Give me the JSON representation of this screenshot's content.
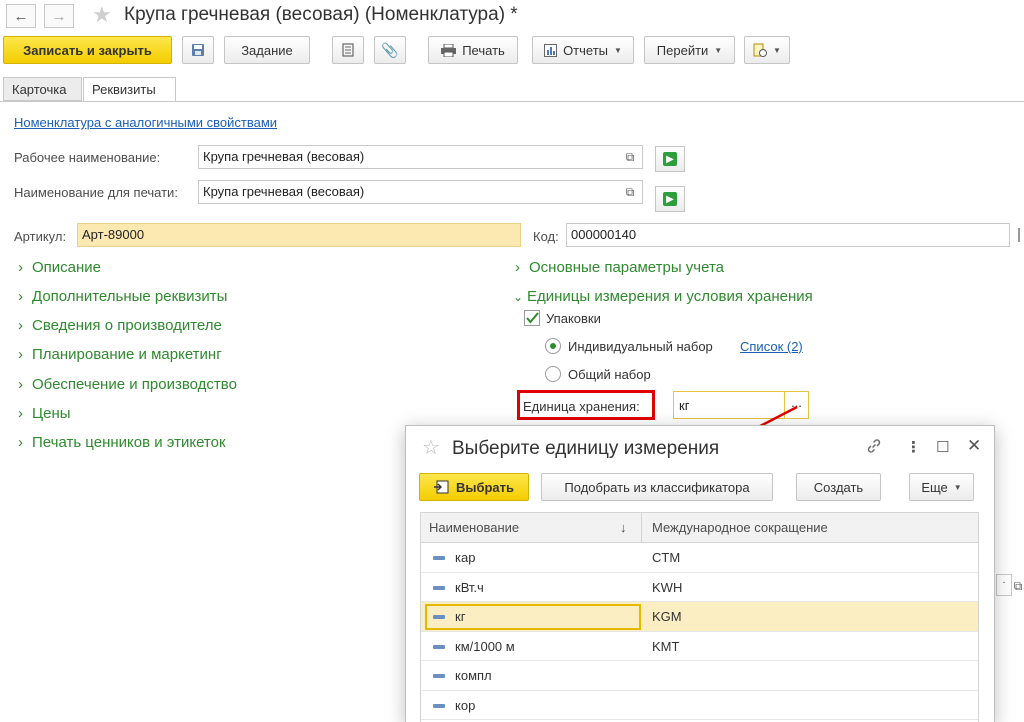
{
  "window": {
    "title": "Крупа гречневая (весовая) (Номенклатура) *"
  },
  "toolbar": {
    "save_close": "Записать и закрыть",
    "task": "Задание",
    "print": "Печать",
    "reports": "Отчеты",
    "goto": "Перейти"
  },
  "tabs": [
    "Карточка",
    "Реквизиты"
  ],
  "form": {
    "similar_link": "Номенклатура с аналогичными свойствами",
    "work_name_label": "Рабочее наименование:",
    "work_name_value": "Крупа гречневая (весовая)",
    "print_name_label": "Наименование для печати:",
    "print_name_value": "Крупа гречневая (весовая)",
    "article_label": "Артикул:",
    "article_value": "Арт-89000",
    "code_label": "Код:",
    "code_value": "000000140"
  },
  "left_groups": [
    "Описание",
    "Дополнительные реквизиты",
    "Сведения о производителе",
    "Планирование и маркетинг",
    "Обеспечение и производство",
    "Цены",
    "Печать ценников и этикеток"
  ],
  "right_groups": {
    "accounting": "Основные параметры учета",
    "units": "Единицы измерения и условия хранения",
    "packaging_label": "Упаковки",
    "individual_set": "Индивидуальный набор",
    "list_link": "Список (2)",
    "common_set": "Общий набор",
    "storage_unit_label": "Единица хранения:",
    "storage_unit_value": "кг",
    "storage_unit_btn": "..."
  },
  "dialog": {
    "title": "Выберите единицу измерения",
    "choose": "Выбрать",
    "classifier": "Подобрать из классификатора",
    "create": "Создать",
    "more": "Еще",
    "col_name": "Наименование",
    "col_intl": "Международное сокращение",
    "sort_arrow": "↓",
    "rows": [
      {
        "name": "кар",
        "code": "CTM"
      },
      {
        "name": "кВт.ч",
        "code": "KWH"
      },
      {
        "name": "кг",
        "code": "KGM"
      },
      {
        "name": "км/1000 м",
        "code": "KMT"
      },
      {
        "name": "компл",
        "code": ""
      },
      {
        "name": "кор",
        "code": ""
      }
    ]
  },
  "colors": {
    "accent_yellow": "#f4cd00",
    "group_green": "#2f8a2f",
    "link_blue": "#1a5fb4",
    "highlight_red": "#e00000"
  }
}
